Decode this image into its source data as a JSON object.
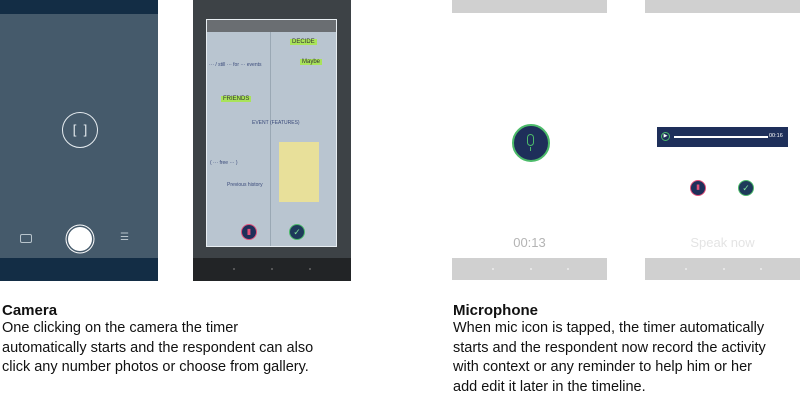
{
  "camera_screen": {
    "icons": [
      "scan-frame-icon",
      "switch-camera-icon",
      "shutter-button",
      "settings-sliders-icon"
    ]
  },
  "photo_preview": {
    "notes": [
      "DECIDE",
      "Maybe",
      "FRIENDS",
      "EVENT (FEATURES)"
    ],
    "icons": [
      "delete-icon",
      "check-icon"
    ]
  },
  "mic_recording": {
    "timer": "00:13",
    "icon": "microphone-icon"
  },
  "mic_review": {
    "duration": "00:16",
    "hint": "Speak now",
    "icons": [
      "play-icon",
      "delete-icon",
      "check-icon"
    ]
  },
  "colors": {
    "camera_bg": "#455a6b",
    "camera_bar": "#132d45",
    "navy": "#1e2f5a",
    "green": "#4cbb6a",
    "pink": "#e0507a",
    "gray_bar": "#d0d0d0"
  },
  "captions": {
    "camera": {
      "title": "Camera",
      "lines": [
        "One clicking on the camera the timer",
        "automatically starts and the respondent can also",
        "click any number photos or choose from gallery."
      ]
    },
    "microphone": {
      "title": "Microphone",
      "lines": [
        "When mic icon is tapped, the timer automatically",
        "starts and the respondent now record the activity",
        "with context or any reminder to help him or her",
        "add edit it later in the timeline."
      ]
    }
  }
}
